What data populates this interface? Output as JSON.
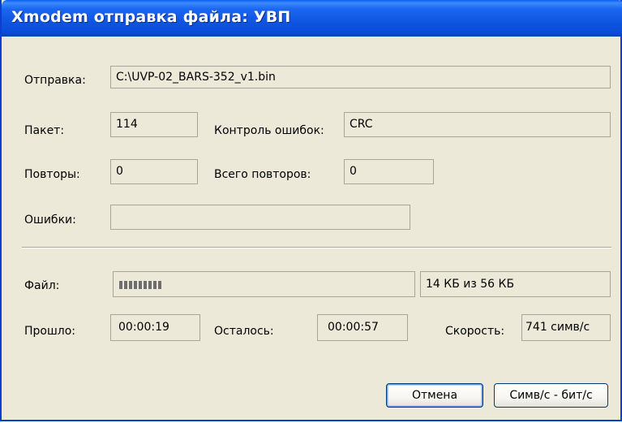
{
  "window": {
    "title": "Xmodem отправка файла: УВП"
  },
  "send": {
    "label": "Отправка:",
    "value": "C:\\UVP-02_BARS-352_v1.bin"
  },
  "packet": {
    "label": "Пакет:",
    "value": "114"
  },
  "error_check": {
    "label": "Контроль ошибок:",
    "value": "CRC"
  },
  "retries": {
    "label": "Повторы:",
    "value": "0"
  },
  "total_retries": {
    "label": "Всего повторов:",
    "value": "0"
  },
  "errors": {
    "label": "Ошибки:",
    "value": ""
  },
  "file": {
    "label": "Файл:",
    "progress_fraction": 0.25,
    "progress_blocks": 9,
    "size_text": "14 КБ из 56 КБ"
  },
  "elapsed": {
    "label": "Прошло:",
    "value": "00:00:19"
  },
  "remaining": {
    "label": "Осталось:",
    "value": "00:00:57"
  },
  "speed": {
    "label": "Скорость:",
    "value": "741 симв/с"
  },
  "buttons": {
    "cancel": "Отмена",
    "units_toggle": "Симв/с - бит/с"
  },
  "colors": {
    "titlebar": "#0a4cd6",
    "dialog_bg": "#ece9d8",
    "progress_block": "#6e6e6e"
  }
}
